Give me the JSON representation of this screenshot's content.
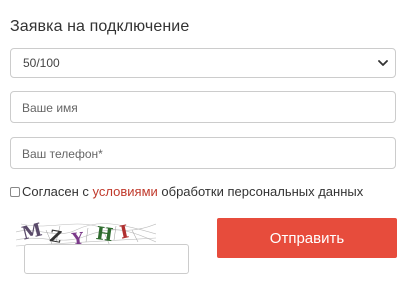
{
  "form": {
    "title": "Заявка на подключение",
    "select": {
      "value": "50/100",
      "icon": "chevron-down-icon"
    },
    "name_input": {
      "placeholder": "Ваше имя",
      "value": ""
    },
    "phone_input": {
      "placeholder": "Ваш телефон*",
      "value": ""
    },
    "consent": {
      "checked": false,
      "text_before": "Согласен с ",
      "link_text": "условиями",
      "text_after": " обработки персональных данных"
    },
    "captcha": {
      "image_text": "MZYHI",
      "input_value": ""
    },
    "submit_label": "Отправить"
  },
  "colors": {
    "accent": "#e74c3c",
    "link": "#c0392b",
    "border": "#cccccc",
    "text": "#333333"
  }
}
